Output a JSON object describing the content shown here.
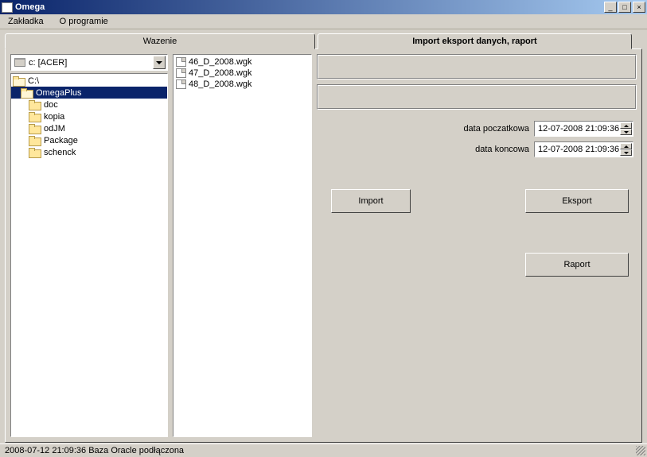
{
  "window": {
    "title": "Omega"
  },
  "menu": {
    "zaklakda": "Zakładka",
    "oprogramie": "O programie"
  },
  "tabs": {
    "left": "Wazenie",
    "right": "Import eksport danych, raport"
  },
  "drive": {
    "label": "c: [ACER]"
  },
  "folders": [
    {
      "name": "C:\\",
      "sel": false,
      "open": true
    },
    {
      "name": "OmegaPlus",
      "sel": true,
      "open": true
    },
    {
      "name": "doc",
      "sel": false,
      "open": false
    },
    {
      "name": "kopia",
      "sel": false,
      "open": false
    },
    {
      "name": "odJM",
      "sel": false,
      "open": false
    },
    {
      "name": "Package",
      "sel": false,
      "open": false
    },
    {
      "name": "schenck",
      "sel": false,
      "open": false
    }
  ],
  "files": [
    "46_D_2008.wgk",
    "47_D_2008.wgk",
    "48_D_2008.wgk"
  ],
  "dates": {
    "start_label": "data poczatkowa",
    "end_label": "data koncowa",
    "start_value": "12-07-2008 21:09:36",
    "end_value": "12-07-2008 21:09:36"
  },
  "buttons": {
    "import": "Import",
    "eksport": "Eksport",
    "raport": "Raport"
  },
  "status": "2008-07-12 21:09:36 Baza Oracle podłączona"
}
